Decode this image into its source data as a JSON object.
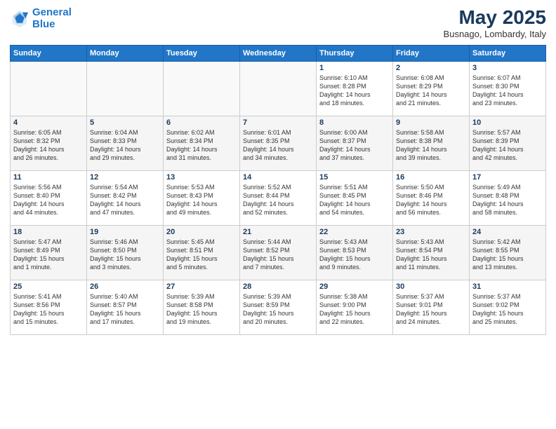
{
  "header": {
    "logo_line1": "General",
    "logo_line2": "Blue",
    "month_title": "May 2025",
    "location": "Busnago, Lombardy, Italy"
  },
  "weekdays": [
    "Sunday",
    "Monday",
    "Tuesday",
    "Wednesday",
    "Thursday",
    "Friday",
    "Saturday"
  ],
  "weeks": [
    [
      {
        "day": "",
        "info": ""
      },
      {
        "day": "",
        "info": ""
      },
      {
        "day": "",
        "info": ""
      },
      {
        "day": "",
        "info": ""
      },
      {
        "day": "1",
        "info": "Sunrise: 6:10 AM\nSunset: 8:28 PM\nDaylight: 14 hours\nand 18 minutes."
      },
      {
        "day": "2",
        "info": "Sunrise: 6:08 AM\nSunset: 8:29 PM\nDaylight: 14 hours\nand 21 minutes."
      },
      {
        "day": "3",
        "info": "Sunrise: 6:07 AM\nSunset: 8:30 PM\nDaylight: 14 hours\nand 23 minutes."
      }
    ],
    [
      {
        "day": "4",
        "info": "Sunrise: 6:05 AM\nSunset: 8:32 PM\nDaylight: 14 hours\nand 26 minutes."
      },
      {
        "day": "5",
        "info": "Sunrise: 6:04 AM\nSunset: 8:33 PM\nDaylight: 14 hours\nand 29 minutes."
      },
      {
        "day": "6",
        "info": "Sunrise: 6:02 AM\nSunset: 8:34 PM\nDaylight: 14 hours\nand 31 minutes."
      },
      {
        "day": "7",
        "info": "Sunrise: 6:01 AM\nSunset: 8:35 PM\nDaylight: 14 hours\nand 34 minutes."
      },
      {
        "day": "8",
        "info": "Sunrise: 6:00 AM\nSunset: 8:37 PM\nDaylight: 14 hours\nand 37 minutes."
      },
      {
        "day": "9",
        "info": "Sunrise: 5:58 AM\nSunset: 8:38 PM\nDaylight: 14 hours\nand 39 minutes."
      },
      {
        "day": "10",
        "info": "Sunrise: 5:57 AM\nSunset: 8:39 PM\nDaylight: 14 hours\nand 42 minutes."
      }
    ],
    [
      {
        "day": "11",
        "info": "Sunrise: 5:56 AM\nSunset: 8:40 PM\nDaylight: 14 hours\nand 44 minutes."
      },
      {
        "day": "12",
        "info": "Sunrise: 5:54 AM\nSunset: 8:42 PM\nDaylight: 14 hours\nand 47 minutes."
      },
      {
        "day": "13",
        "info": "Sunrise: 5:53 AM\nSunset: 8:43 PM\nDaylight: 14 hours\nand 49 minutes."
      },
      {
        "day": "14",
        "info": "Sunrise: 5:52 AM\nSunset: 8:44 PM\nDaylight: 14 hours\nand 52 minutes."
      },
      {
        "day": "15",
        "info": "Sunrise: 5:51 AM\nSunset: 8:45 PM\nDaylight: 14 hours\nand 54 minutes."
      },
      {
        "day": "16",
        "info": "Sunrise: 5:50 AM\nSunset: 8:46 PM\nDaylight: 14 hours\nand 56 minutes."
      },
      {
        "day": "17",
        "info": "Sunrise: 5:49 AM\nSunset: 8:48 PM\nDaylight: 14 hours\nand 58 minutes."
      }
    ],
    [
      {
        "day": "18",
        "info": "Sunrise: 5:47 AM\nSunset: 8:49 PM\nDaylight: 15 hours\nand 1 minute."
      },
      {
        "day": "19",
        "info": "Sunrise: 5:46 AM\nSunset: 8:50 PM\nDaylight: 15 hours\nand 3 minutes."
      },
      {
        "day": "20",
        "info": "Sunrise: 5:45 AM\nSunset: 8:51 PM\nDaylight: 15 hours\nand 5 minutes."
      },
      {
        "day": "21",
        "info": "Sunrise: 5:44 AM\nSunset: 8:52 PM\nDaylight: 15 hours\nand 7 minutes."
      },
      {
        "day": "22",
        "info": "Sunrise: 5:43 AM\nSunset: 8:53 PM\nDaylight: 15 hours\nand 9 minutes."
      },
      {
        "day": "23",
        "info": "Sunrise: 5:43 AM\nSunset: 8:54 PM\nDaylight: 15 hours\nand 11 minutes."
      },
      {
        "day": "24",
        "info": "Sunrise: 5:42 AM\nSunset: 8:55 PM\nDaylight: 15 hours\nand 13 minutes."
      }
    ],
    [
      {
        "day": "25",
        "info": "Sunrise: 5:41 AM\nSunset: 8:56 PM\nDaylight: 15 hours\nand 15 minutes."
      },
      {
        "day": "26",
        "info": "Sunrise: 5:40 AM\nSunset: 8:57 PM\nDaylight: 15 hours\nand 17 minutes."
      },
      {
        "day": "27",
        "info": "Sunrise: 5:39 AM\nSunset: 8:58 PM\nDaylight: 15 hours\nand 19 minutes."
      },
      {
        "day": "28",
        "info": "Sunrise: 5:39 AM\nSunset: 8:59 PM\nDaylight: 15 hours\nand 20 minutes."
      },
      {
        "day": "29",
        "info": "Sunrise: 5:38 AM\nSunset: 9:00 PM\nDaylight: 15 hours\nand 22 minutes."
      },
      {
        "day": "30",
        "info": "Sunrise: 5:37 AM\nSunset: 9:01 PM\nDaylight: 15 hours\nand 24 minutes."
      },
      {
        "day": "31",
        "info": "Sunrise: 5:37 AM\nSunset: 9:02 PM\nDaylight: 15 hours\nand 25 minutes."
      }
    ]
  ]
}
